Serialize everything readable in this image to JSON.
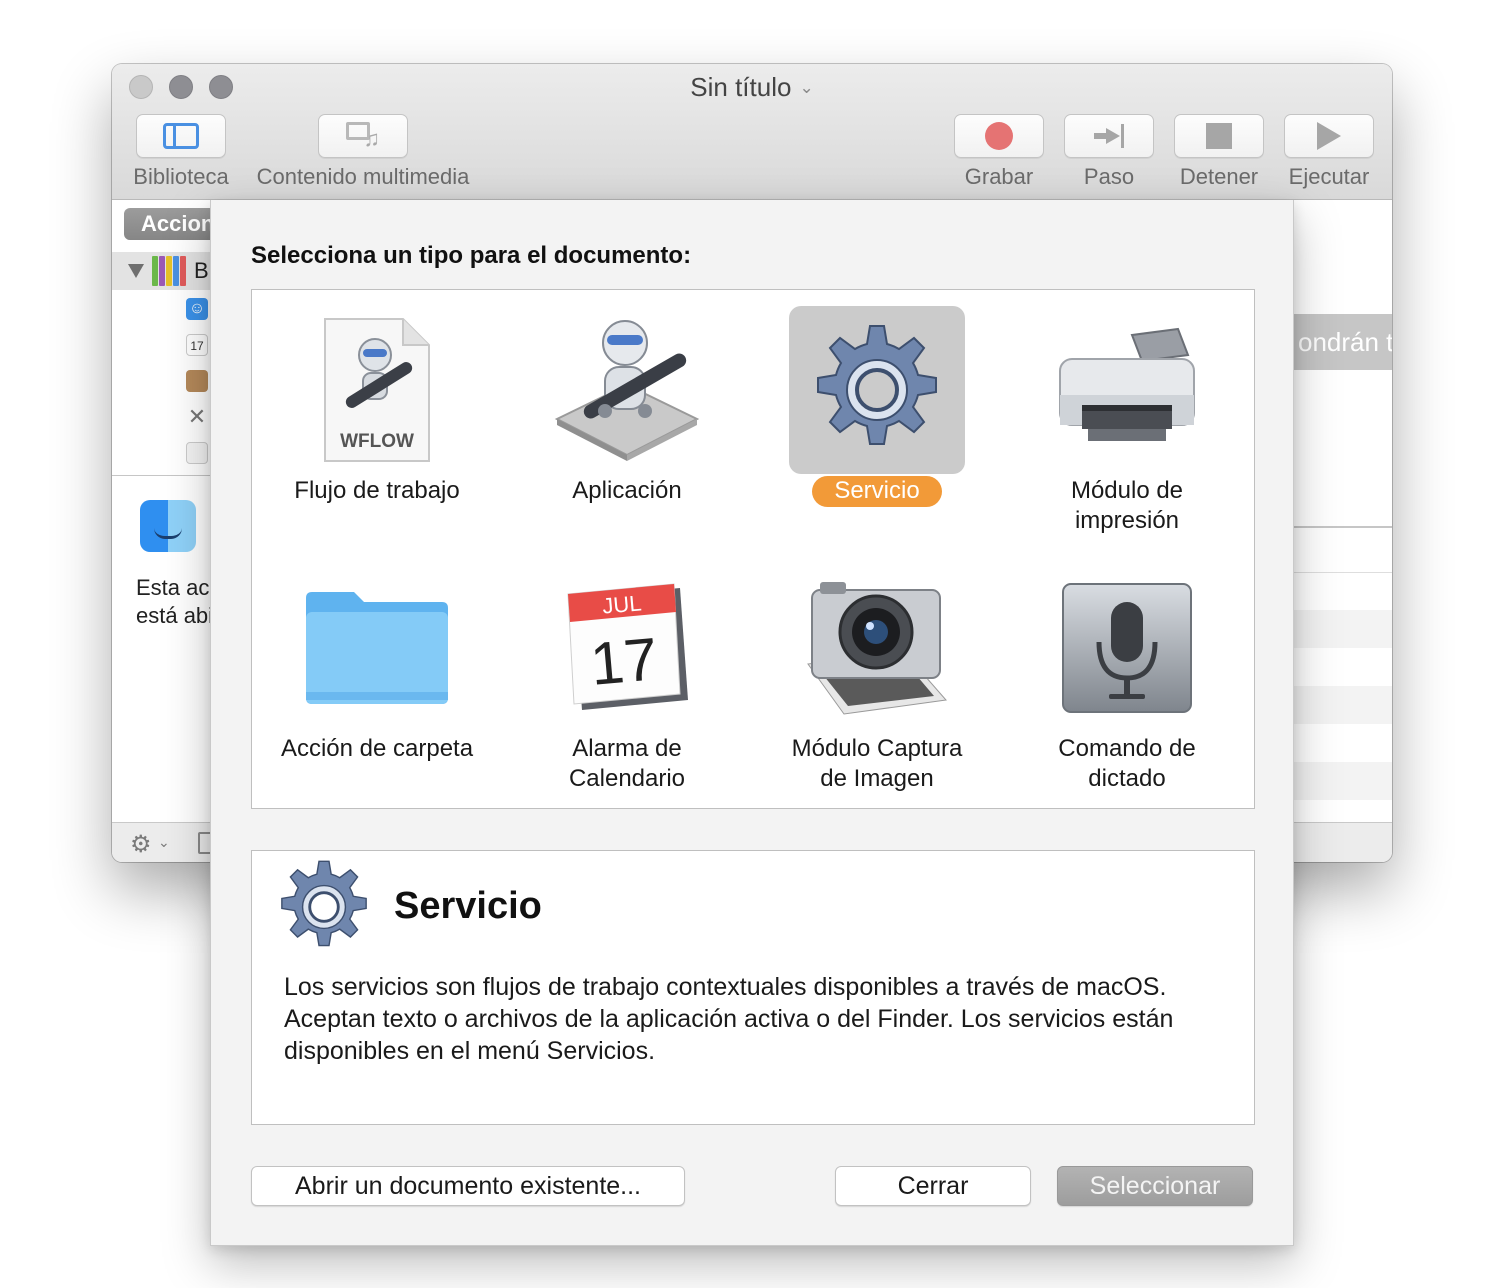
{
  "window": {
    "title": "Sin título",
    "title_chevron": "⌄"
  },
  "toolbar": {
    "library_label": "Biblioteca",
    "media_label": "Contenido multimedia",
    "record_label": "Grabar",
    "step_label": "Paso",
    "stop_label": "Detener",
    "run_label": "Ejecutar"
  },
  "sidebar": {
    "header": "Acciones",
    "tree_label": "Biblioteca",
    "description_line1": "Esta acción",
    "description_line2": "está abierta"
  },
  "content": {
    "banner_text": "ondrán tu"
  },
  "sheet": {
    "title": "Selecciona un tipo para el documento:",
    "types": [
      {
        "label": "Flujo de trabajo",
        "icon": "workflow-file-icon",
        "file_badge": "WFLOW",
        "selected": false
      },
      {
        "label": "Aplicación",
        "icon": "automator-robot-icon",
        "selected": false
      },
      {
        "label": "Servicio",
        "icon": "gear-icon",
        "selected": true
      },
      {
        "label": "Módulo de impresión",
        "icon": "printer-icon",
        "selected": false
      },
      {
        "label": "Acción de carpeta",
        "icon": "folder-icon",
        "selected": false
      },
      {
        "label": "Alarma de Calendario",
        "icon": "calendar-icon",
        "calendar_month": "JUL",
        "calendar_day": "17",
        "selected": false
      },
      {
        "label": "Módulo Captura de Imagen",
        "icon": "camera-icon",
        "selected": false
      },
      {
        "label": "Comando de dictado",
        "icon": "microphone-icon",
        "selected": false
      }
    ],
    "info": {
      "title": "Servicio",
      "description": "Los servicios son flujos de trabajo contextuales disponibles a través de macOS. Aceptan texto o archivos de la aplicación activa o del Finder. Los servicios están disponibles en el menú Servicios."
    },
    "buttons": {
      "open_existing": "Abrir un documento existente...",
      "close": "Cerrar",
      "select": "Seleccionar"
    }
  },
  "colors": {
    "selection_pill": "#f29a38",
    "record": "#e57373",
    "accent_blue": "#4a90e2"
  }
}
